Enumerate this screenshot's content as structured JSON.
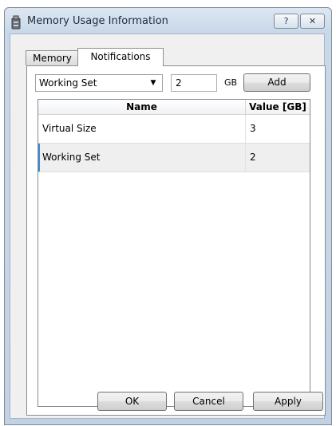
{
  "window": {
    "title": "Memory Usage Information",
    "help_label": "?",
    "close_label": "✕"
  },
  "tabs": [
    {
      "label": "Memory",
      "selected": false
    },
    {
      "label": "Notifications",
      "selected": true
    }
  ],
  "notification_form": {
    "counter_selected": "Working Set",
    "value": "2",
    "unit": "GB",
    "add_label": "Add"
  },
  "table": {
    "columns": [
      "Name",
      "Value [GB]"
    ],
    "rows": [
      {
        "name": "Virtual Size",
        "value": "3"
      },
      {
        "name": "Working Set",
        "value": "2"
      }
    ]
  },
  "footer": {
    "ok_label": "OK",
    "cancel_label": "Cancel",
    "apply_label": "Apply"
  }
}
